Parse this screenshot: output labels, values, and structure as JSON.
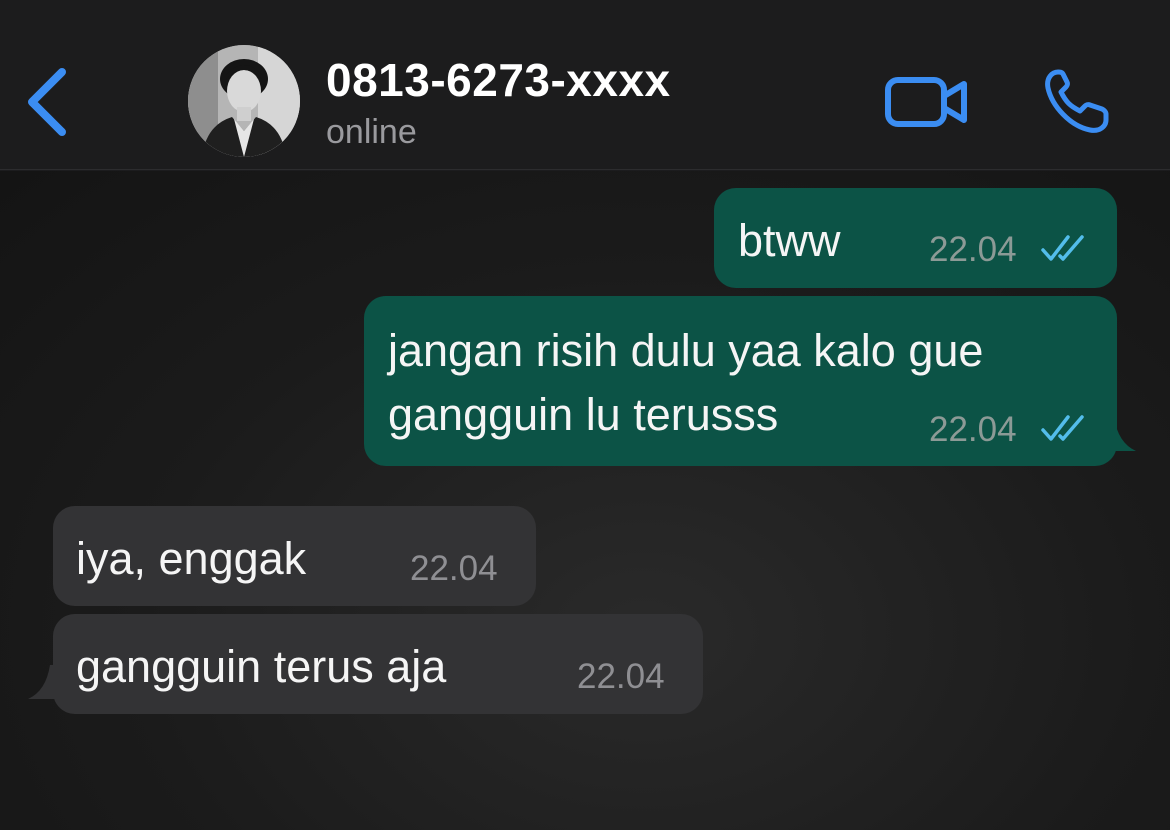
{
  "header": {
    "contact_name": "0813-6273-xxxx",
    "status": "online"
  },
  "messages": [
    {
      "direction": "out",
      "text": "btww",
      "time": "22.04",
      "read": true
    },
    {
      "direction": "out",
      "text_lines": [
        "jangan risih dulu yaa kalo gue",
        "gangguin lu terusss"
      ],
      "time": "22.04",
      "read": true
    },
    {
      "direction": "in",
      "text": "iya, enggak",
      "time": "22.04"
    },
    {
      "direction": "in",
      "text": "gangguin terus aja",
      "time": "22.04"
    }
  ],
  "colors": {
    "accent": "#3b8df2",
    "outgoing_bubble": "#0c5346",
    "incoming_bubble": "#333335",
    "read_ticks": "#53bdeb"
  },
  "icons": {
    "back": "chevron-left-icon",
    "video": "video-camera-icon",
    "call": "phone-icon",
    "read_receipt": "double-check-icon"
  }
}
